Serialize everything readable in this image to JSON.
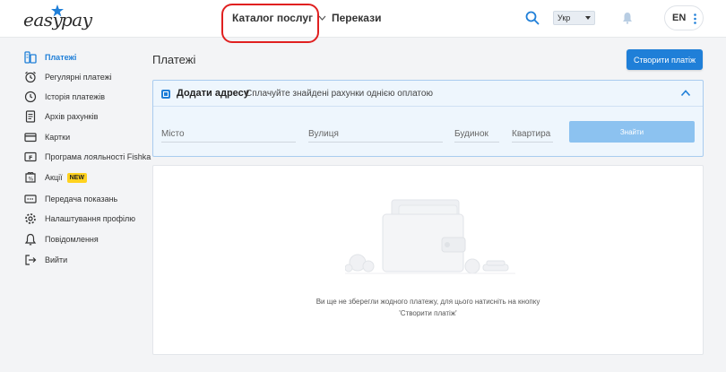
{
  "header": {
    "logo_left": "easy",
    "logo_right": "pay",
    "catalog_label": "Каталог послуг",
    "transfers_label": "Перекази",
    "lang_value": "Укр",
    "user_label": "EN"
  },
  "sidebar": {
    "items": [
      {
        "label": "Платежі",
        "icon": "payments-icon"
      },
      {
        "label": "Регулярні платежі",
        "icon": "alarm-clock-icon"
      },
      {
        "label": "Історія платежів",
        "icon": "history-icon"
      },
      {
        "label": "Архів рахунків",
        "icon": "document-icon"
      },
      {
        "label": "Картки",
        "icon": "card-icon"
      },
      {
        "label": "Програма лояльності Fishka",
        "icon": "loyalty-card-icon"
      },
      {
        "label": "Акції",
        "icon": "promo-icon",
        "badge": "NEW"
      },
      {
        "label": "Передача показань",
        "icon": "meter-icon"
      },
      {
        "label": "Налаштування профілю",
        "icon": "gear-icon"
      },
      {
        "label": "Повідомлення",
        "icon": "bell-icon"
      },
      {
        "label": "Вийти",
        "icon": "logout-icon"
      }
    ]
  },
  "main": {
    "page_title": "Платежі",
    "create_button": "Створити платіж",
    "address": {
      "title": "Додати адресу",
      "subtitle": "Сплачуйте знайдені рахунки однією оплатою",
      "city_placeholder": "Місто",
      "street_placeholder": "Вулиця",
      "house_placeholder": "Будинок",
      "apartment_placeholder": "Квартира",
      "find_button": "Знайти"
    },
    "empty": {
      "line1": "Ви ще не зберегли жодного платежу, для цього натисніть на кнопку",
      "line2": "'Створити платіж'"
    }
  },
  "colors": {
    "accent": "#1f7fd8",
    "badge": "#ffd21f",
    "highlight_ring": "#e02020"
  }
}
